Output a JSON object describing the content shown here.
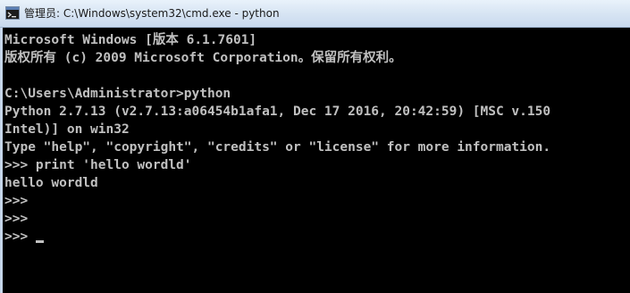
{
  "window": {
    "title": "管理员: C:\\Windows\\system32\\cmd.exe - python",
    "icon": "cmd-icon"
  },
  "console": {
    "lines": [
      "Microsoft Windows [版本 6.1.7601]",
      "版权所有 (c) 2009 Microsoft Corporation。保留所有权利。",
      "",
      "C:\\Users\\Administrator>python",
      "Python 2.7.13 (v2.7.13:a06454b1afa1, Dec 17 2016, 20:42:59) [MSC v.150",
      "Intel)] on win32",
      "Type \"help\", \"copyright\", \"credits\" or \"license\" for more information.",
      ">>> print 'hello wordld'",
      "hello wordld",
      ">>>",
      ">>>"
    ],
    "active_prompt": ">>>"
  },
  "colors": {
    "console_background": "#000000",
    "console_text": "#c0c0c0"
  }
}
